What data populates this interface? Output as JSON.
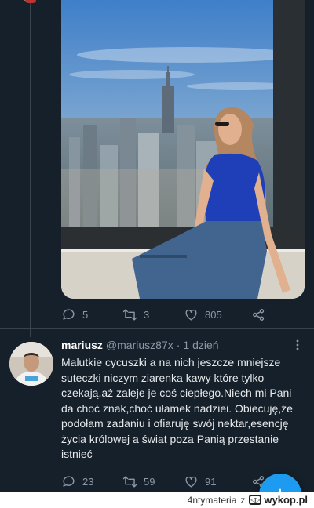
{
  "tweet": {
    "actions": {
      "replies": "5",
      "retweets": "3",
      "likes": "805"
    }
  },
  "reply": {
    "author_name": "mariusz",
    "author_handle": "@mariusz87x",
    "separator": "·",
    "time": "1 dzień",
    "text": "Malutkie cycuszki a na nich jeszcze mniejsze suteczki niczym ziarenka kawy które tylko czekają,aż zaleje je coś ciepłego.Niech mi Pani da choć znak,choć ułamek nadziei. Obiecuję,że podołam zadaniu i ofiaruję swój nektar,esencję życia królowej a świat poza Panią przestanie istnieć",
    "actions": {
      "replies": "23",
      "retweets": "59",
      "likes": "91"
    }
  },
  "compose": {
    "icon": "+"
  },
  "footer": {
    "user": "4ntymateria",
    "connector": "z",
    "brand": "wykop.pl"
  },
  "colors": {
    "background": "#15202b",
    "muted": "#8b98a5",
    "accent": "#1d9bf0",
    "divider": "#38444d"
  }
}
